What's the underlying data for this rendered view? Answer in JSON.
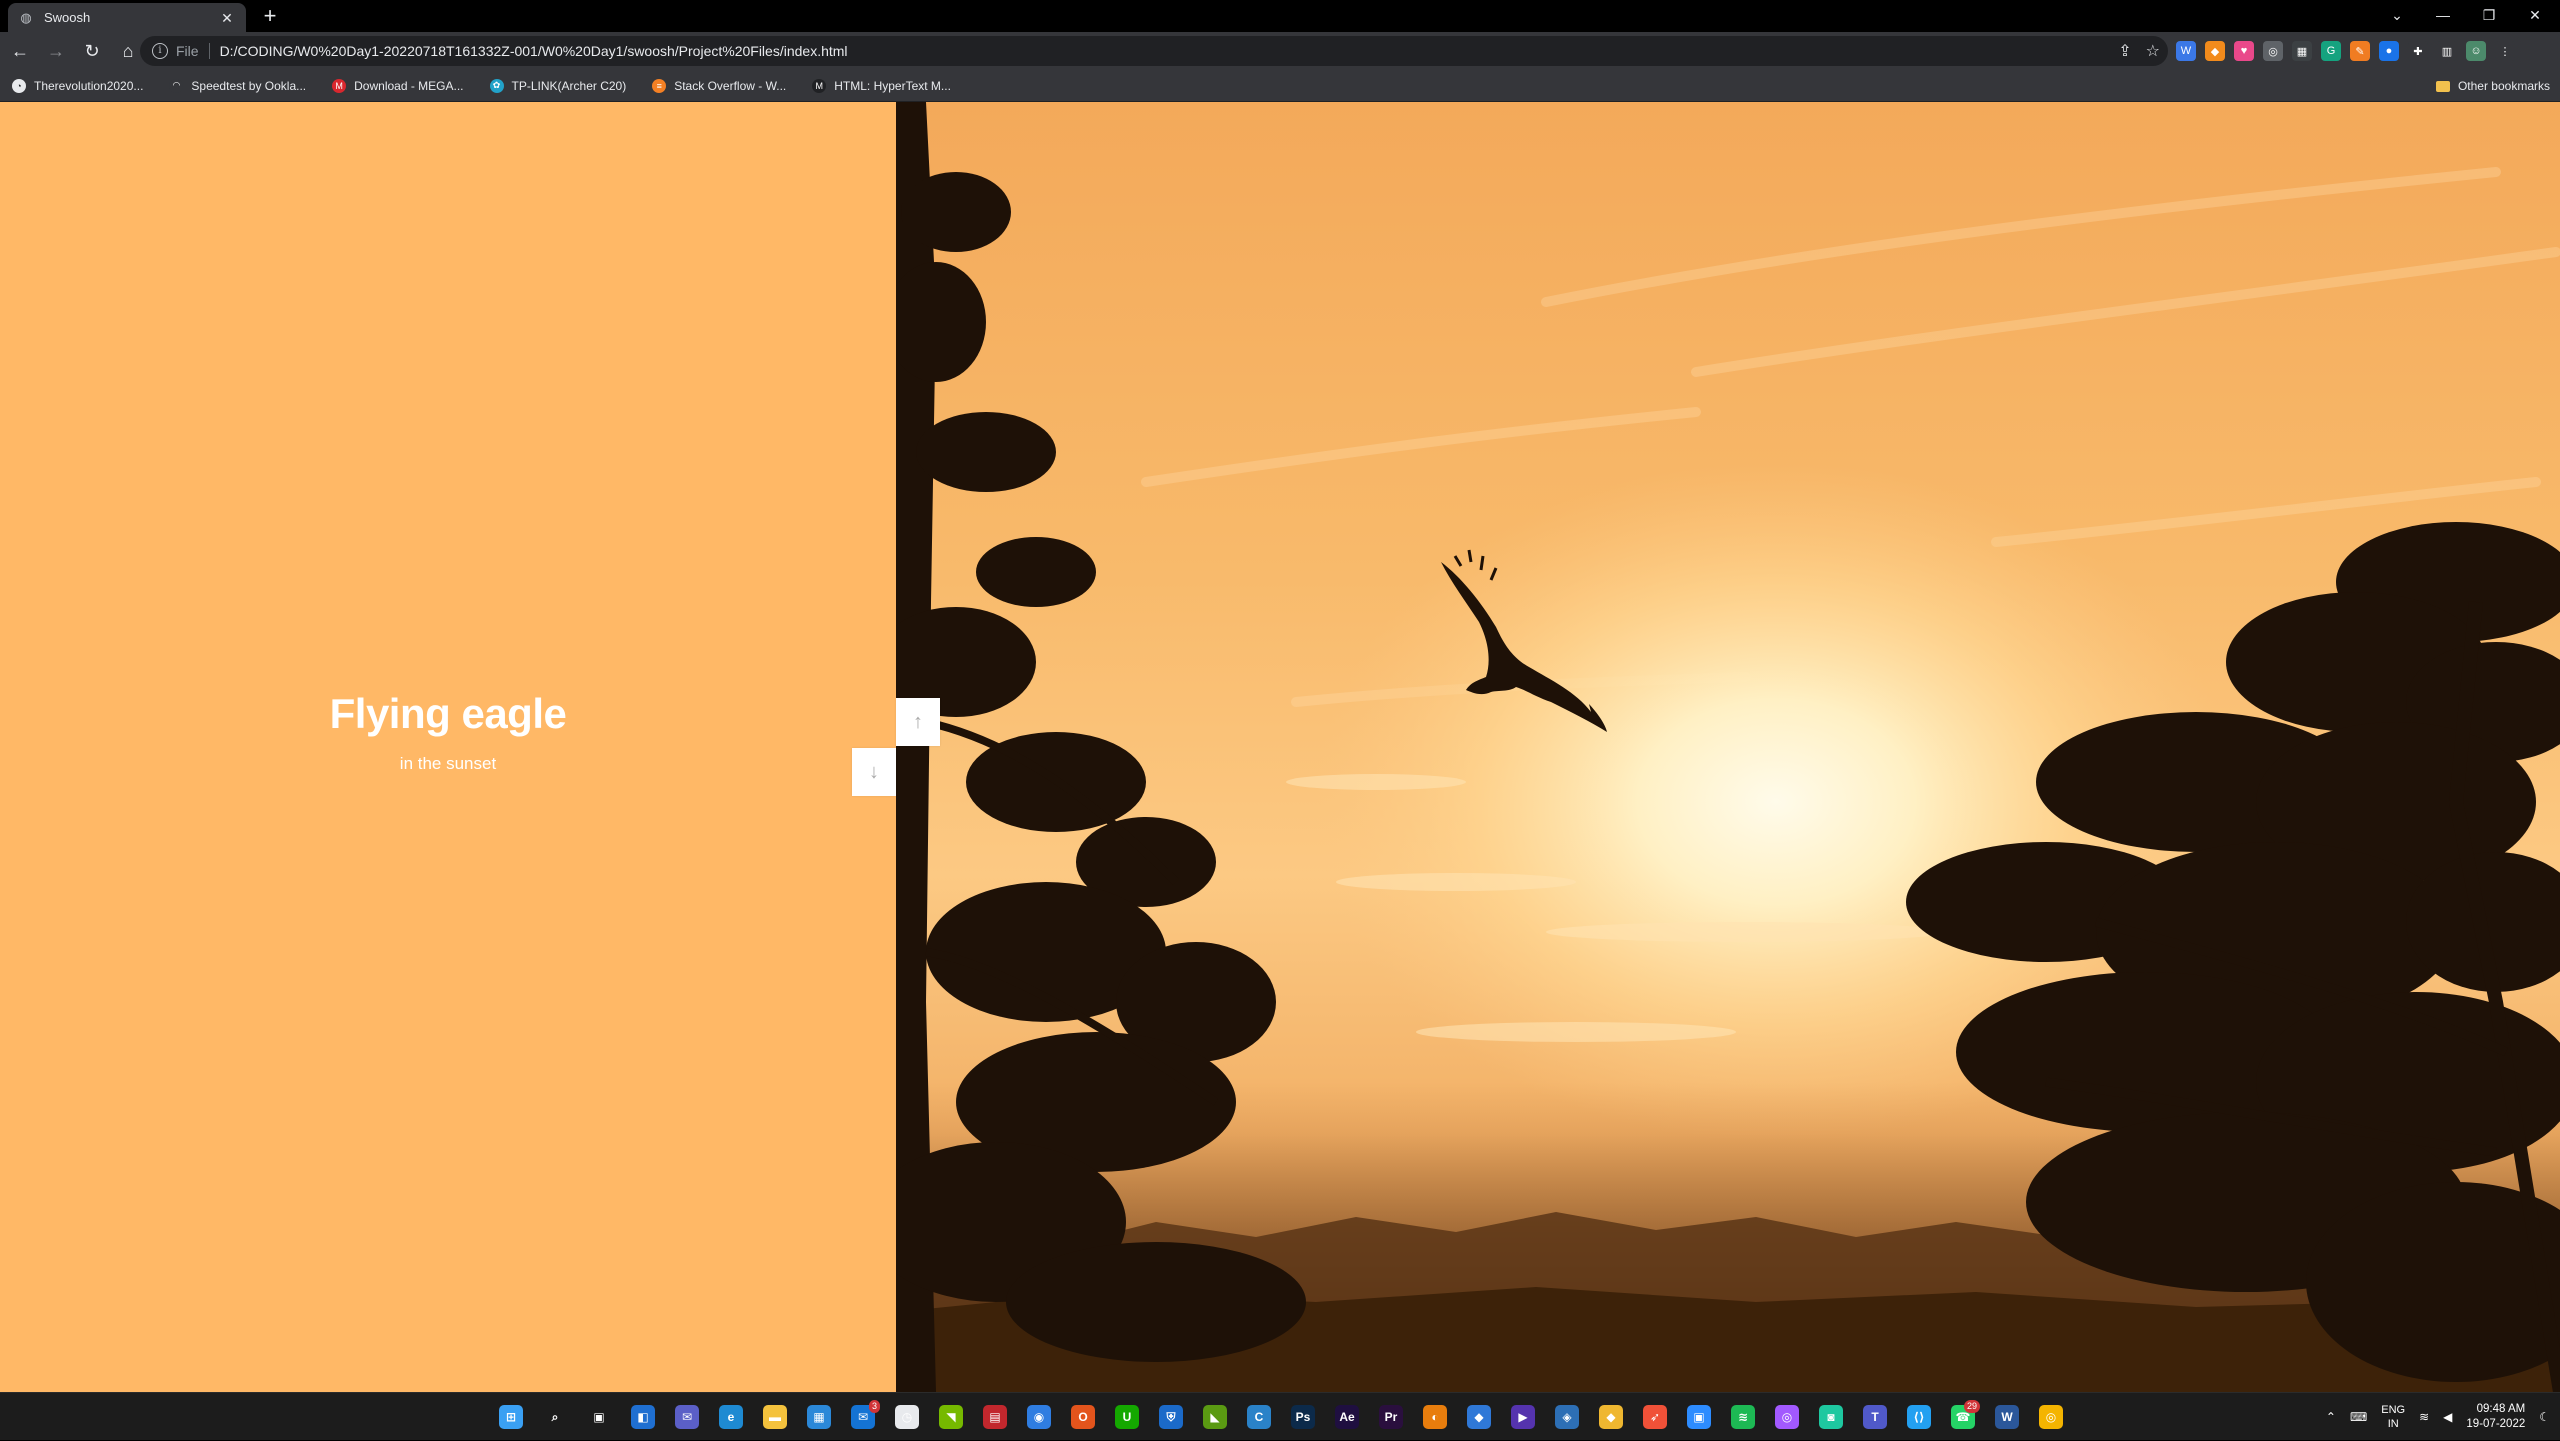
{
  "browser": {
    "tab": {
      "title": "Swoosh",
      "close": "✕"
    },
    "new_tab": "+",
    "window_controls": {
      "dropdown": "⌄",
      "minimize": "—",
      "restore": "❐",
      "close": "✕"
    },
    "address": {
      "scheme": "File",
      "url": "D:/CODING/W0%20Day1-20220718T161332Z-001/W0%20Day1/swoosh/Project%20Files/index.html"
    },
    "nav": {
      "back": "←",
      "forward": "→",
      "reload": "↻",
      "home": "⌂"
    },
    "extensions": [
      {
        "name": "ext-1-icon",
        "glyph": "W",
        "color": "#3b78e7"
      },
      {
        "name": "ext-2-icon",
        "glyph": "◆",
        "color": "#f28b1c"
      },
      {
        "name": "ext-3-icon",
        "glyph": "♥",
        "color": "#e9488a"
      },
      {
        "name": "ext-4-icon",
        "glyph": "◎",
        "color": "#5f6368"
      },
      {
        "name": "ext-5-icon",
        "glyph": "▦",
        "color": "#3c4043"
      },
      {
        "name": "ext-6-icon",
        "glyph": "G",
        "color": "#15a37f"
      },
      {
        "name": "ext-7-icon",
        "glyph": "✎",
        "color": "#f07c22"
      },
      {
        "name": "ext-8-icon",
        "glyph": "●",
        "color": "#1a73e8"
      },
      {
        "name": "extensions-puzzle-icon",
        "glyph": "✚",
        "color": "#35363a"
      },
      {
        "name": "side-panel-icon",
        "glyph": "▥",
        "color": "#35363a"
      },
      {
        "name": "profile-avatar-icon",
        "glyph": "☺",
        "color": "#4c8a6b"
      },
      {
        "name": "menu-kebab-icon",
        "glyph": "⋮",
        "color": "#35363a"
      }
    ]
  },
  "bookmarks": {
    "items": [
      {
        "label": "Therevolution2020...",
        "color": "#e8eaed",
        "glyph": "◔"
      },
      {
        "label": "Speedtest by Ookla...",
        "color": "#35363a",
        "glyph": "◠"
      },
      {
        "label": "Download - MEGA...",
        "color": "#d9272e",
        "glyph": "M"
      },
      {
        "label": "TP-LINK(Archer C20)",
        "color": "#22a2c9",
        "glyph": "✿"
      },
      {
        "label": "Stack Overflow - W...",
        "color": "#f48024",
        "glyph": "≡"
      },
      {
        "label": "HTML: HyperText M...",
        "color": "#202124",
        "glyph": "M"
      }
    ],
    "other": "Other bookmarks"
  },
  "slide": {
    "title": "Flying eagle",
    "subtitle": "in the sunset",
    "up_arrow": "↑",
    "down_arrow": "↓",
    "left_bg": "#ffb866"
  },
  "taskbar": {
    "icons": [
      {
        "name": "start-icon",
        "glyph": "⊞",
        "color": "#3aa0f3"
      },
      {
        "name": "search-icon",
        "glyph": "⌕",
        "color": "#1c1c1c"
      },
      {
        "name": "task-view-icon",
        "glyph": "▣",
        "color": "#1c1c1c"
      },
      {
        "name": "widgets-icon",
        "glyph": "◧",
        "color": "#1f6fd1"
      },
      {
        "name": "chat-icon",
        "glyph": "✉",
        "color": "#5b5fc7"
      },
      {
        "name": "edge-icon",
        "glyph": "e",
        "color": "#1e8ad2"
      },
      {
        "name": "file-explorer-icon",
        "glyph": "▬",
        "color": "#f4c23d"
      },
      {
        "name": "store-icon",
        "glyph": "▦",
        "color": "#2b88d8"
      },
      {
        "name": "mail-icon",
        "glyph": "✉",
        "color": "#1473d4",
        "badge": "3"
      },
      {
        "name": "clock-app-icon",
        "glyph": "◷",
        "color": "#e8eaed"
      },
      {
        "name": "nvidia-icon",
        "glyph": "◥",
        "color": "#76b900"
      },
      {
        "name": "media-app-icon",
        "glyph": "▤",
        "color": "#c2272d"
      },
      {
        "name": "browser-app-icon",
        "glyph": "◉",
        "color": "#2f7de1"
      },
      {
        "name": "office-icon",
        "glyph": "O",
        "color": "#e3541c"
      },
      {
        "name": "upwork-icon",
        "glyph": "U",
        "color": "#14a800"
      },
      {
        "name": "security-app-icon",
        "glyph": "⛨",
        "color": "#1b6ac9"
      },
      {
        "name": "nvidia-geforce-icon",
        "glyph": "◣",
        "color": "#5a9a12"
      },
      {
        "name": "cursor-app-icon",
        "glyph": "C",
        "color": "#2a82c8"
      },
      {
        "name": "photoshop-icon",
        "glyph": "Ps",
        "color": "#0c2a4a"
      },
      {
        "name": "after-effects-icon",
        "glyph": "Ae",
        "color": "#1f0f40"
      },
      {
        "name": "premiere-icon",
        "glyph": "Pr",
        "color": "#2a0f3e"
      },
      {
        "name": "blender-icon",
        "glyph": "◐",
        "color": "#e87d0d"
      },
      {
        "name": "network-app-icon",
        "glyph": "◆",
        "color": "#2f78d7"
      },
      {
        "name": "video-app-icon",
        "glyph": "▶",
        "color": "#5533ae"
      },
      {
        "name": "wifi-app-icon",
        "glyph": "◈",
        "color": "#2d6fb5"
      },
      {
        "name": "git-app-icon",
        "glyph": "◆",
        "color": "#efb730"
      },
      {
        "name": "swift-app-icon",
        "glyph": "➶",
        "color": "#f05138"
      },
      {
        "name": "zoom-icon",
        "glyph": "▣",
        "color": "#2d8cff"
      },
      {
        "name": "spotify-icon",
        "glyph": "≋",
        "color": "#1db954"
      },
      {
        "name": "figma-icon",
        "glyph": "◎",
        "color": "#a259ff"
      },
      {
        "name": "android-app-icon",
        "glyph": "◙",
        "color": "#1ec8a0"
      },
      {
        "name": "teams-icon",
        "glyph": "T",
        "color": "#5059c9"
      },
      {
        "name": "vscode-icon",
        "glyph": "⟨⟩",
        "color": "#23a0f1"
      },
      {
        "name": "whatsapp-icon",
        "glyph": "☎",
        "color": "#25d366",
        "badge": "29"
      },
      {
        "name": "word-icon",
        "glyph": "W",
        "color": "#2b579a"
      },
      {
        "name": "chrome-icon",
        "glyph": "◎",
        "color": "#f4b400"
      }
    ],
    "tray": {
      "chevron": "⌃",
      "keyboard": "⌨",
      "lang_1": "ENG",
      "lang_2": "IN",
      "wifi": "≋",
      "volume": "◀",
      "time": "09:48 AM",
      "date": "19-07-2022",
      "notification": "☾"
    }
  }
}
